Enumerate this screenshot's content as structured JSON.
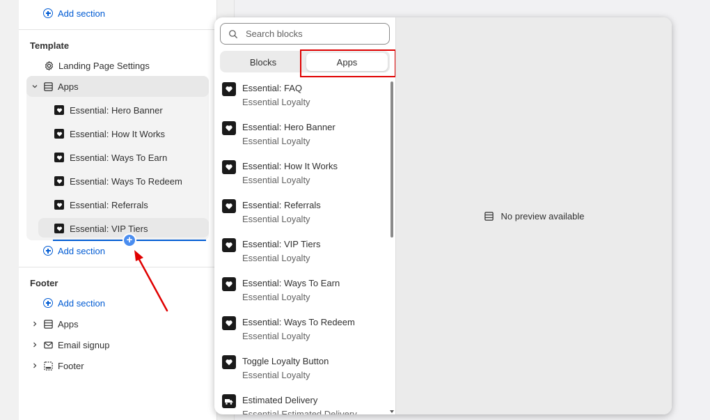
{
  "sidebar": {
    "top_add_section": "Add section",
    "template": {
      "title": "Template",
      "settings_label": "Landing Page Settings",
      "apps_label": "Apps",
      "blocks": [
        "Essential: Hero Banner",
        "Essential: How It Works",
        "Essential: Ways To Earn",
        "Essential: Ways To Redeem",
        "Essential: Referrals",
        "Essential: VIP Tiers"
      ],
      "add_section": "Add section"
    },
    "footer": {
      "title": "Footer",
      "add_section": "Add section",
      "items": [
        "Apps",
        "Email signup",
        "Footer"
      ]
    }
  },
  "popup": {
    "search_placeholder": "Search blocks",
    "tabs": [
      "Blocks",
      "Apps"
    ],
    "active_tab": "Apps",
    "items": [
      {
        "title": "Essential: FAQ",
        "subtitle": "Essential Loyalty"
      },
      {
        "title": "Essential: Hero Banner",
        "subtitle": "Essential Loyalty"
      },
      {
        "title": "Essential: How It Works",
        "subtitle": "Essential Loyalty"
      },
      {
        "title": "Essential: Referrals",
        "subtitle": "Essential Loyalty"
      },
      {
        "title": "Essential: VIP Tiers",
        "subtitle": "Essential Loyalty"
      },
      {
        "title": "Essential: Ways To Earn",
        "subtitle": "Essential Loyalty"
      },
      {
        "title": "Essential: Ways To Redeem",
        "subtitle": "Essential Loyalty"
      },
      {
        "title": "Toggle Loyalty Button",
        "subtitle": "Essential Loyalty"
      },
      {
        "title": "Estimated Delivery",
        "subtitle": "Essential Estimated Delivery"
      }
    ],
    "preview_text": "No preview available"
  },
  "colors": {
    "link_blue": "#005bd3",
    "annotation_red": "#e00000",
    "insert_dot": "#4a8df0"
  }
}
